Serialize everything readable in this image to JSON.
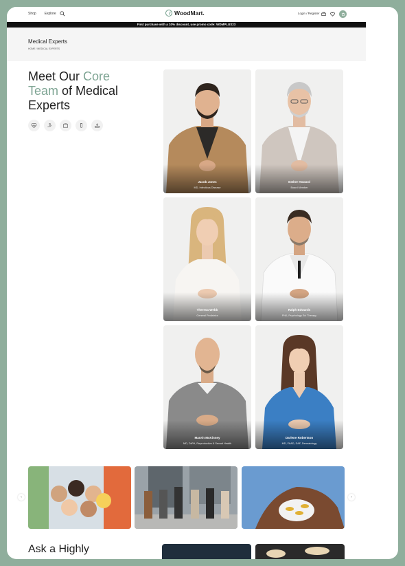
{
  "header": {
    "nav": [
      "Shop",
      "Explore"
    ],
    "logo": "WoodMart.",
    "login": "Login / Register",
    "cart_count": "0"
  },
  "promo": "First purchase with a 10% discount, use promo code: WDMPLUS23",
  "page": {
    "title": "Medical Experts",
    "breadcrumb": "HOME  /  MEDICAL EXPERTS"
  },
  "headline": {
    "part1": "Meet Our ",
    "accent1": "Core",
    "accent2": "Team",
    "part2": " of Medical Experts"
  },
  "specialty_icons": [
    "heart-pulse-icon",
    "hand-care-icon",
    "kit-icon",
    "vial-icon",
    "tray-icon"
  ],
  "experts": [
    {
      "name": "Jacob Jones",
      "role": "MD, Infectious Disease"
    },
    {
      "name": "Esther Howard",
      "role": "Board Member"
    },
    {
      "name": "Theresa Webb",
      "role": "General Pediatrics"
    },
    {
      "name": "Ralph Edwards",
      "role": "PhD, Psychology Sci Therapy"
    },
    {
      "name": "Marvin McKinney",
      "role": "MD, DrPH, Reproductive & Sexual Health"
    },
    {
      "name": "Darlene Robertson",
      "role": "MD, FAAD, DAF, Dermatology"
    }
  ],
  "section2": {
    "title": "Ask a Highly"
  },
  "colors": {
    "accent": "#7fa594",
    "frame": "#8fae9c",
    "promo_bg": "#111111"
  }
}
